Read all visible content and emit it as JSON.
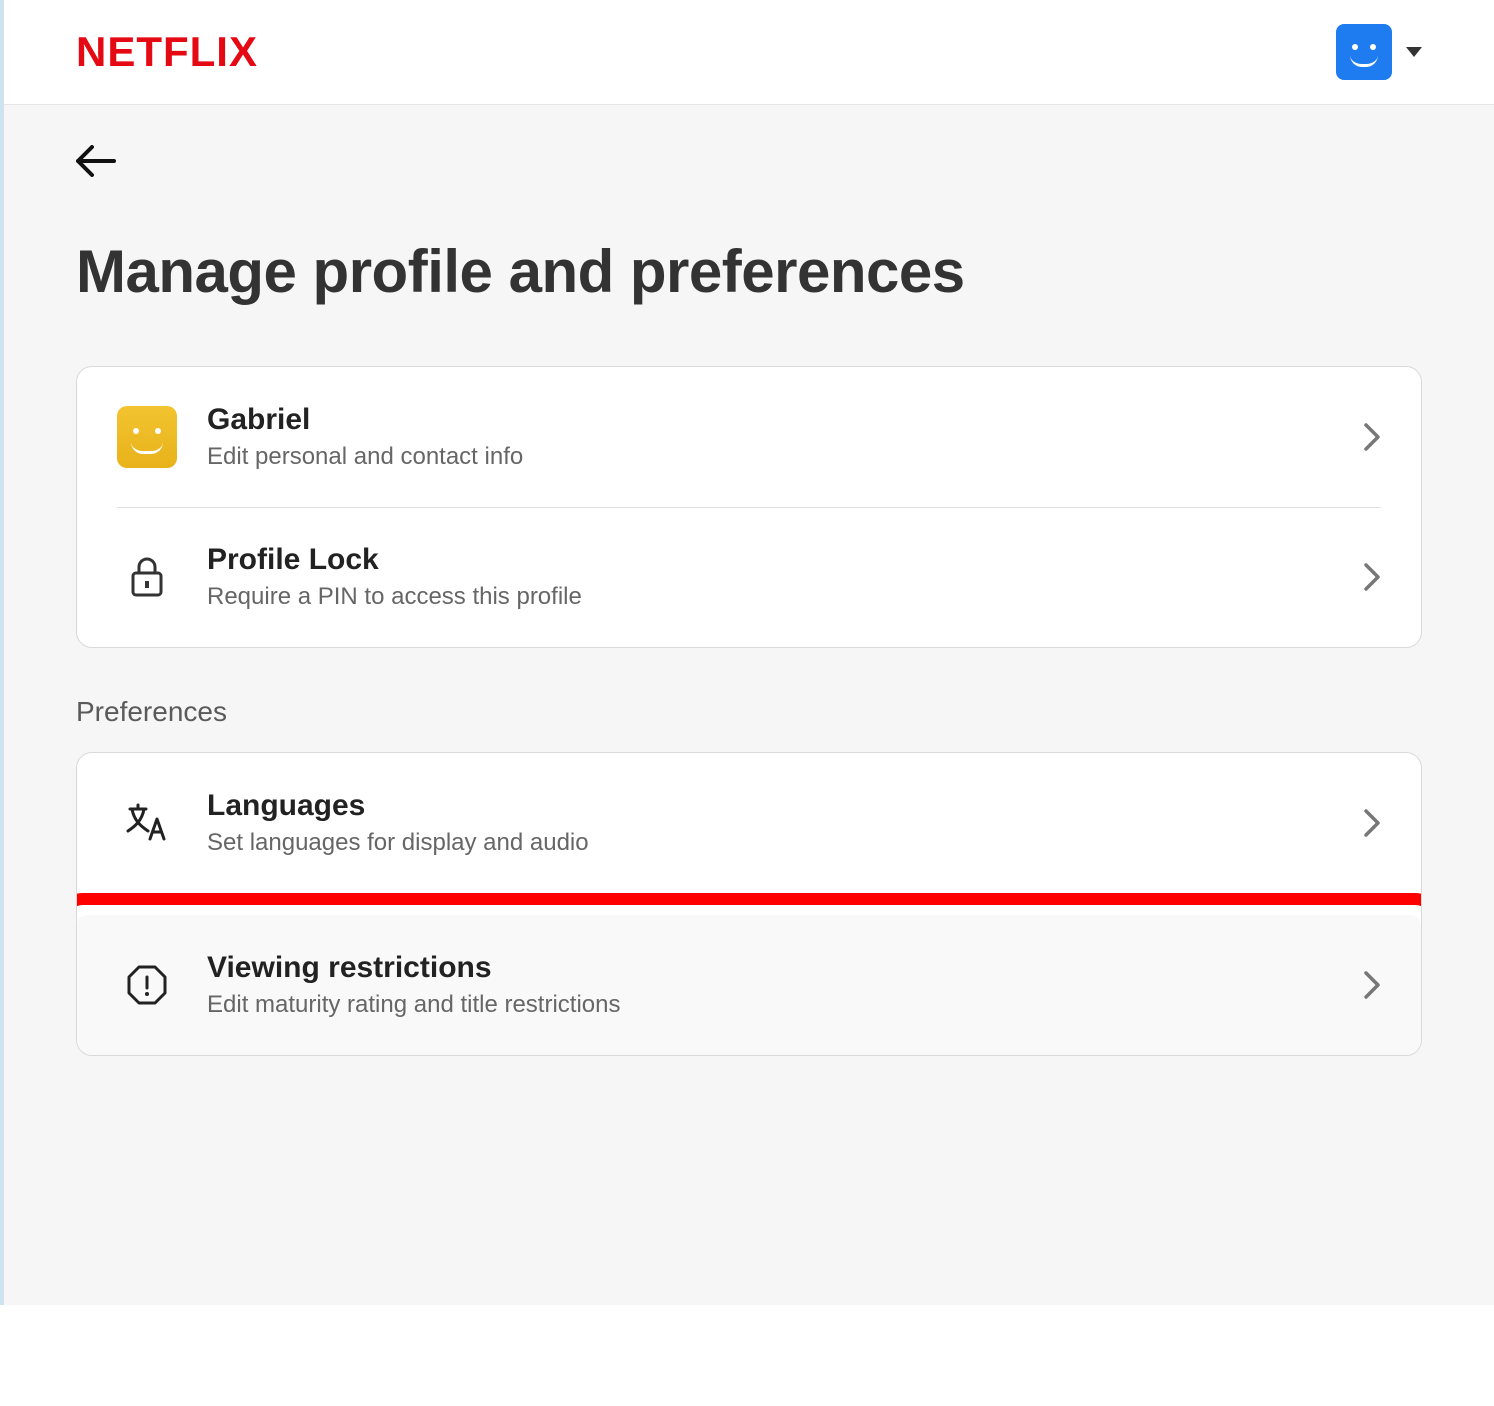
{
  "header": {
    "logo_text": "NETFLIX"
  },
  "page": {
    "title": "Manage profile and preferences"
  },
  "profile_card": {
    "items": [
      {
        "title": "Gabriel",
        "subtitle": "Edit personal and contact info"
      },
      {
        "title": "Profile Lock",
        "subtitle": "Require a PIN to access this profile"
      }
    ]
  },
  "preferences": {
    "label": "Preferences",
    "items": [
      {
        "title": "Languages",
        "subtitle": "Set languages for display and audio"
      },
      {
        "title": "Viewing restrictions",
        "subtitle": "Edit maturity rating and title restrictions"
      }
    ]
  },
  "icons": {
    "lock": "lock-icon",
    "language": "language-icon",
    "warning": "warning-octagon-icon"
  },
  "colors": {
    "brand_red": "#e50914",
    "highlight": "#f00",
    "avatar_blue": "#1f7cf0",
    "avatar_yellow": "#e8b21a"
  }
}
